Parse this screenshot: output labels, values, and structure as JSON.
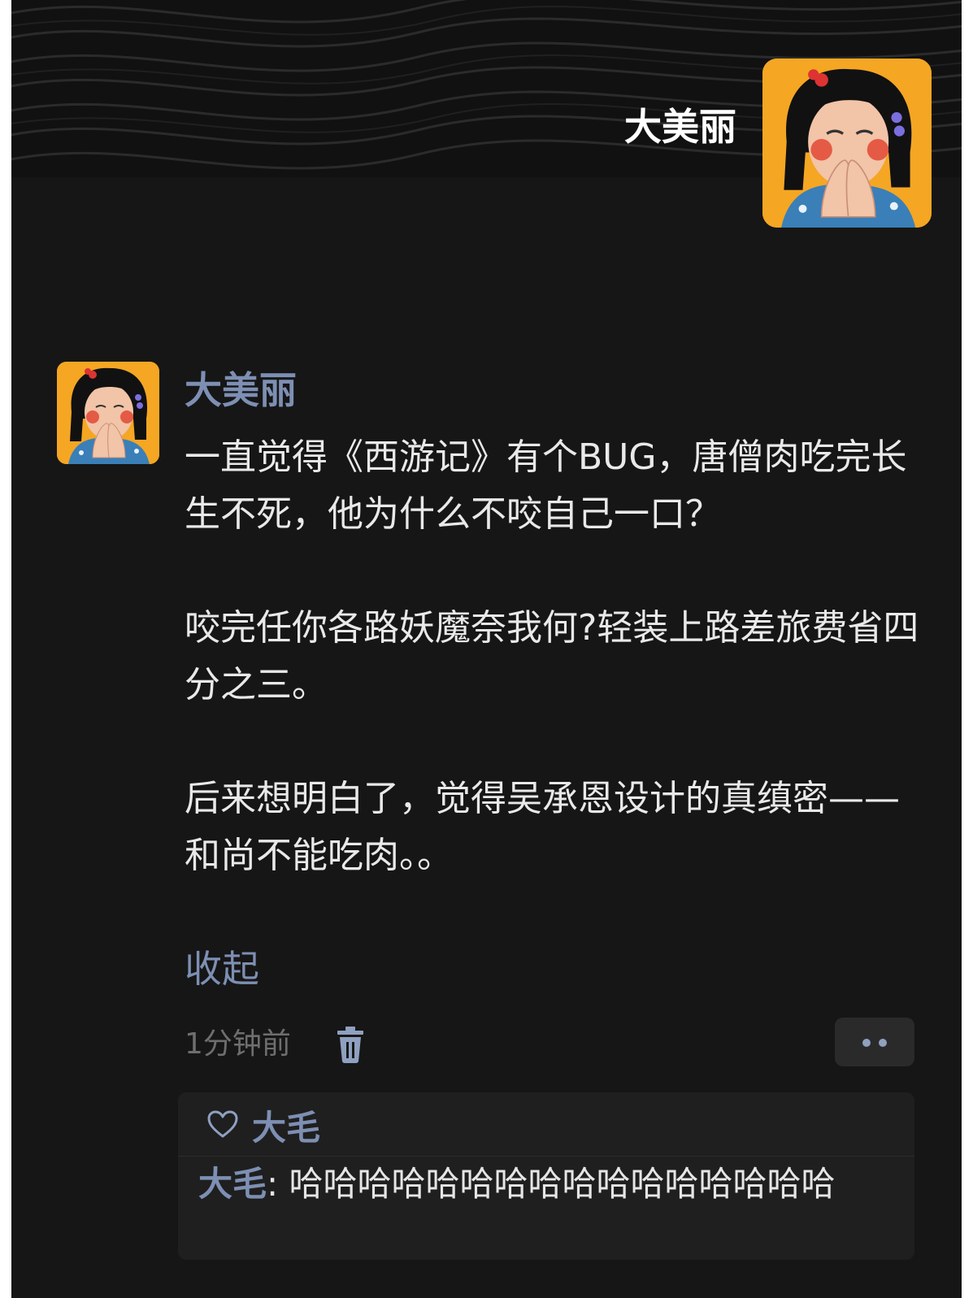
{
  "profile": {
    "display_name": "大美丽"
  },
  "post": {
    "author": "大美丽",
    "paragraphs": [
      "一直觉得《西游记》有个BUG，唐僧肉吃完长生不死，他为什么不咬自己一口？",
      "咬完任你各路妖魔奈我何?轻装上路差旅费省四分之三。",
      "后来想明白了，觉得吴承恩设计的真缜密——和尚不能吃肉。。"
    ],
    "collapse_label": "收起",
    "time": "1分钟前"
  },
  "interactions": {
    "likes": [
      "大毛"
    ],
    "comments": [
      {
        "author": "大毛",
        "separator": ": ",
        "text": "哈哈哈哈哈哈哈哈哈哈哈哈哈哈哈哈"
      }
    ]
  },
  "colors": {
    "background": "#161616",
    "link_blue": "#7d8fb3",
    "avatar_bg": "#f5a623"
  },
  "icons": [
    "trash-icon",
    "more-dots-icon",
    "heart-outline-icon",
    "avatar-illustration"
  ]
}
